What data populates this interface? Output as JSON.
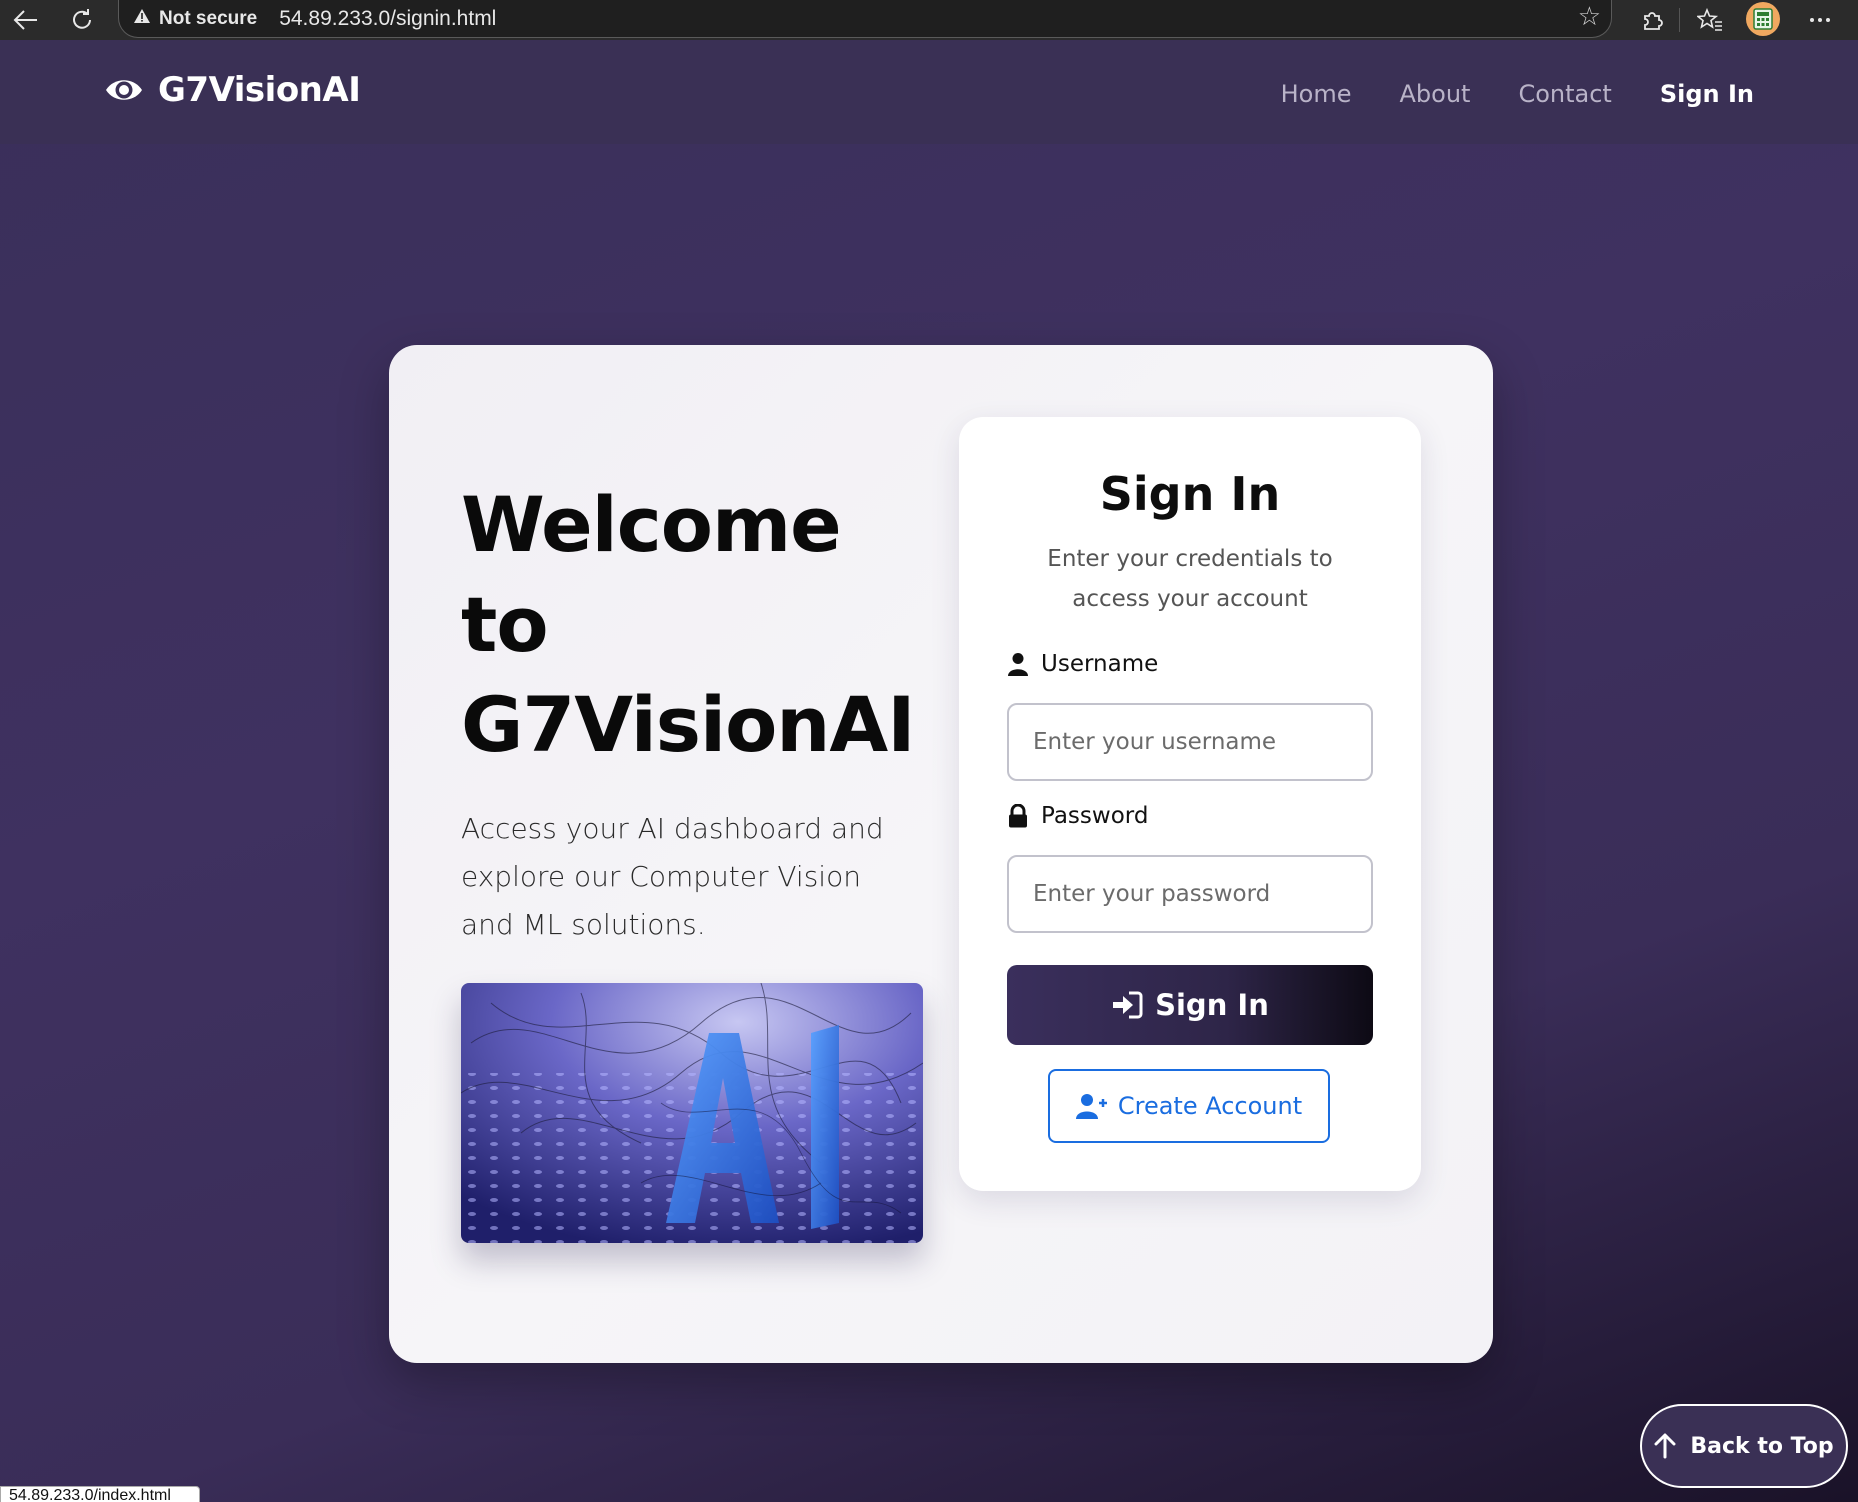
{
  "browser": {
    "security_label": "Not secure",
    "url": "54.89.233.0/signin.html",
    "status_url": "54.89.233.0/index.html"
  },
  "nav": {
    "brand": "G7VisionAI",
    "links": [
      {
        "label": "Home"
      },
      {
        "label": "About"
      },
      {
        "label": "Contact"
      },
      {
        "label": "Sign In"
      }
    ]
  },
  "hero": {
    "title": "Welcome to G7VisionAI",
    "description": "Access your AI dashboard and explore our Computer Vision and ML solutions."
  },
  "signin": {
    "title": "Sign In",
    "subtitle": "Enter your credentials to access your account",
    "username_label": "Username",
    "username_placeholder": "Enter your username",
    "password_label": "Password",
    "password_placeholder": "Enter your password",
    "submit_label": "Sign In",
    "create_label": "Create Account"
  },
  "back_to_top": "Back to Top",
  "colors": {
    "accent": "#3a2f5c",
    "link_blue": "#1a6de0",
    "background": "#3b2f5c"
  }
}
